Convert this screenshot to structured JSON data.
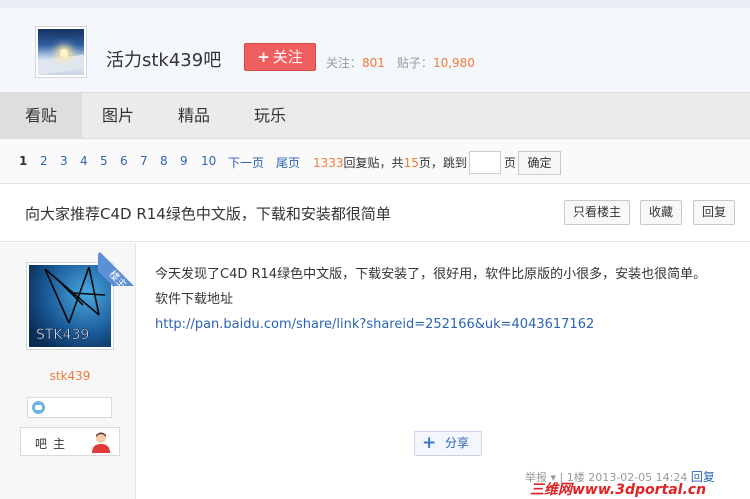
{
  "forum": {
    "name": "活力stk439吧",
    "follow_label": "关注",
    "follow_plus": "+",
    "stats": {
      "followers_label": "关注：",
      "followers": "801",
      "posts_label": "贴子：",
      "posts": "10,980"
    }
  },
  "tabs": [
    {
      "label": "看贴",
      "active": true
    },
    {
      "label": "图片",
      "active": false
    },
    {
      "label": "精品",
      "active": false
    },
    {
      "label": "玩乐",
      "active": false
    }
  ],
  "pager": {
    "pages": [
      "1",
      "2",
      "3",
      "4",
      "5",
      "6",
      "7",
      "8",
      "9",
      "10"
    ],
    "current": "1",
    "next_label": "下一页",
    "last_label": "尾页",
    "reply_count": "1333",
    "reply_text": "回复贴，共",
    "total_pages": "15",
    "pages_text": "页，跳到",
    "page_unit": "页",
    "confirm_label": "确定"
  },
  "thread": {
    "title": "向大家推荐C4D R14绿色中文版，下载和安装都很简单",
    "only_owner_label": "只看楼主",
    "favorite_label": "收藏",
    "reply_label": "回复"
  },
  "post": {
    "badge": "楼主",
    "author": "stk439",
    "avatar_text": "STK439",
    "owner_label": "吧主",
    "line1": "今天发现了C4D R14绿色中文版，下载安装了，很好用，软件比原版的小很多，安装也很简单。",
    "line2": "软件下载地址",
    "link": "http://pan.baidu.com/share/link?shareid=252166&uk=4043617162",
    "share_label": "分享",
    "share_plus": "+",
    "footer": {
      "report": "举报",
      "floor": "1楼",
      "time": "2013-02-05 14:24",
      "reply": "回复"
    }
  },
  "watermark": "三维网www.3dportal.cn",
  "colors": {
    "accent_orange": "#f07b3a",
    "link_blue": "#2d64b3",
    "follow_red": "#f05f5f",
    "badge_blue": "#5d8fd6"
  }
}
